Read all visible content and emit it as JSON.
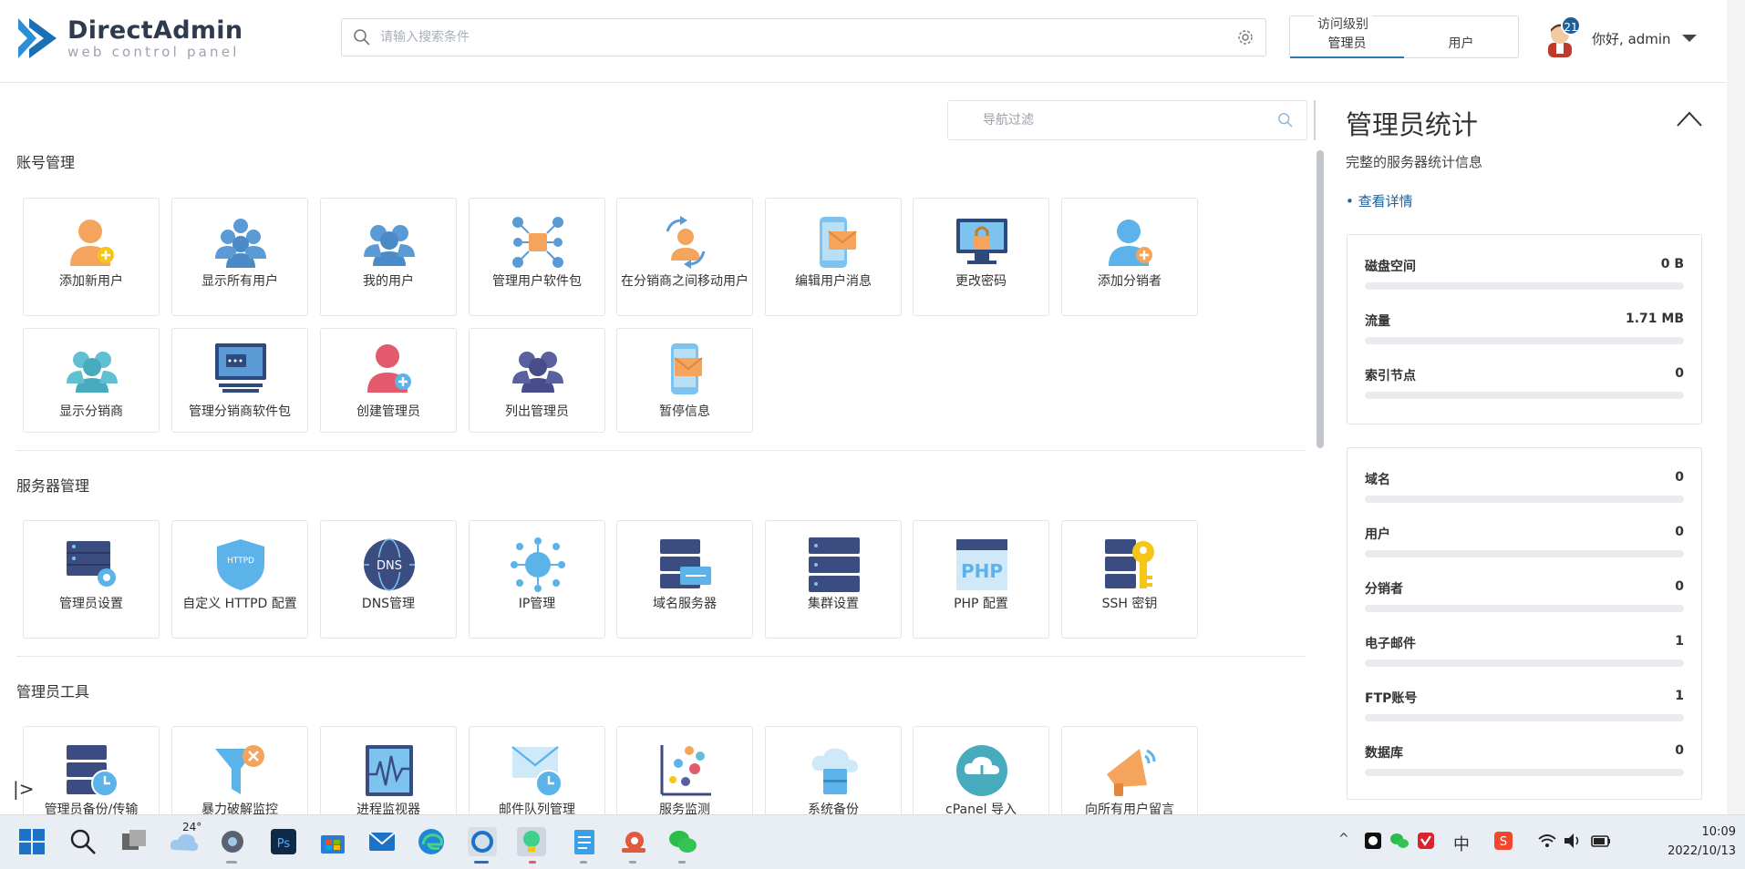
{
  "logo": {
    "title": "DirectAdmin",
    "subtitle": "web control panel"
  },
  "search": {
    "placeholder": "请输入搜索条件"
  },
  "access_level": {
    "title": "访问级别",
    "tabs": [
      "管理员",
      "用户"
    ],
    "active": "管理员"
  },
  "user": {
    "greeting": "你好,",
    "name": "admin",
    "notifications": "21"
  },
  "nav_filter": {
    "placeholder": "导航过滤"
  },
  "sections": [
    {
      "title": "账号管理",
      "items": [
        "添加新用户",
        "显示所有用户",
        "我的用户",
        "管理用户软件包",
        "在分销商之间移动用户",
        "编辑用户消息",
        "更改密码",
        "添加分销者",
        "显示分销商",
        "管理分销商软件包",
        "创建管理员",
        "列出管理员",
        "暂停信息"
      ]
    },
    {
      "title": "服务器管理",
      "items": [
        "管理员设置",
        "自定义 HTTPD 配置",
        "DNS管理",
        "IP管理",
        "域名服务器",
        "集群设置",
        "PHP 配置",
        "SSH 密钥"
      ]
    },
    {
      "title": "管理员工具",
      "items": [
        "管理员备份/传输",
        "暴力破解监控",
        "进程监视器",
        "邮件队列管理",
        "服务监测",
        "系统备份",
        "cPanel 导入",
        "向所有用户留言"
      ]
    }
  ],
  "stats_panel": {
    "title": "管理员统计",
    "subtitle": "完整的服务器统计信息",
    "link": "• 查看详情",
    "usage": [
      {
        "label": "磁盘空间",
        "value": "0 B"
      },
      {
        "label": "流量",
        "value": "1.71 MB"
      },
      {
        "label": "索引节点",
        "value": "0"
      }
    ],
    "counts": [
      {
        "label": "域名",
        "value": "0"
      },
      {
        "label": "用户",
        "value": "0"
      },
      {
        "label": "分销者",
        "value": "0"
      },
      {
        "label": "电子邮件",
        "value": "1"
      },
      {
        "label": "FTP账号",
        "value": "1"
      },
      {
        "label": "数据库",
        "value": "0"
      }
    ]
  },
  "taskbar": {
    "weather": "24°",
    "ime": "中",
    "time": "10:09",
    "date": "2022/10/13"
  },
  "colors": {
    "accent": "#1f5f96",
    "logo": "#2a8fd6",
    "tile_border": "#e3e5e8"
  }
}
